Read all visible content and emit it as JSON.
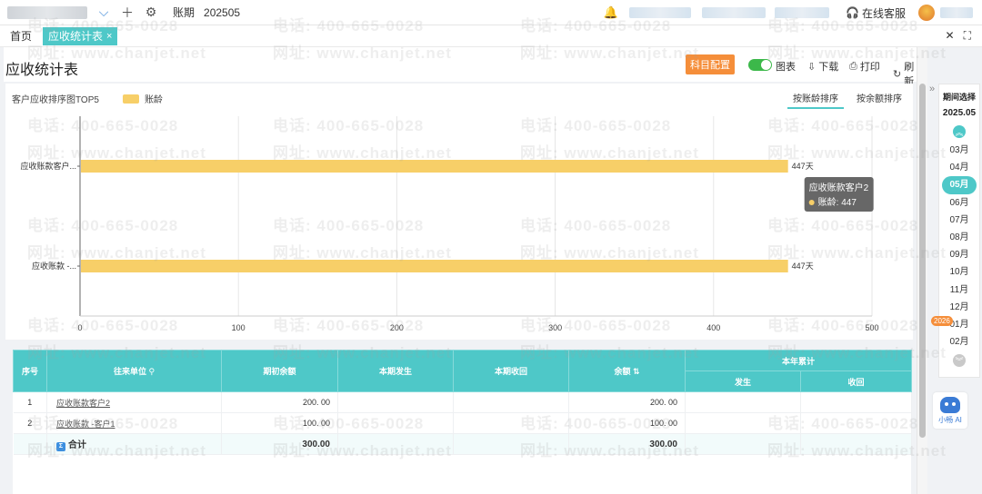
{
  "topbar": {
    "icons": [
      "chevron-down-icon",
      "plus-icon",
      "gear-icon",
      "bell-icon",
      "headset-icon"
    ],
    "period_label": "账期",
    "period_value": "202505",
    "service_label": "在线客服"
  },
  "tabs": {
    "home": "首页",
    "active": "应收统计表",
    "close_glyph": "×",
    "window_close": "✕",
    "window_expand": "⛶"
  },
  "page": {
    "title": "应收统计表",
    "subject_config_btn": "科目配置",
    "chart_toggle_label": "图表",
    "download_label": "下载",
    "print_label": "打印",
    "refresh_label": "刷新"
  },
  "chart": {
    "heading": "客户应收排序图TOP5",
    "sort_by_age": "按账龄排序",
    "sort_by_balance": "按余额排序",
    "tooltip_title": "应收账款客户2",
    "tooltip_value": "账龄: 447"
  },
  "chart_data": {
    "type": "bar",
    "orientation": "horizontal",
    "categories": [
      "应收账款客户...",
      "应收账款 -..."
    ],
    "series": [
      {
        "name": "账龄",
        "values": [
          447,
          447
        ]
      }
    ],
    "value_labels": [
      "447天",
      "447天"
    ],
    "xlim": [
      0,
      500
    ],
    "xticks": [
      "0",
      "100",
      "200",
      "300",
      "400",
      "500"
    ],
    "grid": true,
    "legend": "top-left",
    "color": "#f7cf68"
  },
  "table": {
    "headers": {
      "seq": "序号",
      "partner": "往来单位",
      "opening": "期初余额",
      "period_occur": "本期发生",
      "period_recv": "本期收回",
      "balance": "余额",
      "ytd": "本年累计",
      "ytd_occur": "发生",
      "ytd_recv": "收回"
    },
    "rows": [
      {
        "seq": "1",
        "partner": "应收账款客户2",
        "opening": "200. 00",
        "period_occur": "",
        "period_recv": "",
        "balance": "200. 00",
        "ytd_occur": "",
        "ytd_recv": ""
      },
      {
        "seq": "2",
        "partner": "应收账款 -客户1",
        "opening": "100. 00",
        "period_occur": "",
        "period_recv": "",
        "balance": "100. 00",
        "ytd_occur": "",
        "ytd_recv": ""
      }
    ],
    "total": {
      "label": "合计",
      "opening": "300.00",
      "balance": "300.00"
    }
  },
  "period_panel": {
    "title": "期间选择",
    "current": "2025.05",
    "months": [
      "03月",
      "04月",
      "05月",
      "06月",
      "07月",
      "08月",
      "09月",
      "10月",
      "11月",
      "12月",
      "01月",
      "02月"
    ],
    "active_month": "05月",
    "year_badge": "2026"
  },
  "ai": {
    "label": "小畅 AI"
  },
  "watermark": {
    "phone": "电话: 400-665-0028",
    "site": "网址: www.chanjet.net"
  }
}
